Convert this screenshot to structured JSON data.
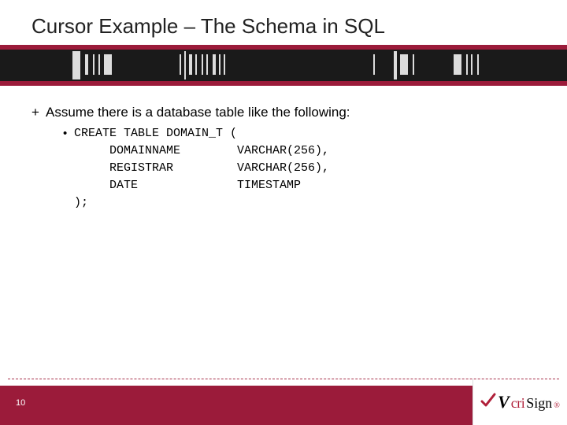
{
  "title": "Cursor Example – The Schema in SQL",
  "bullet_text": "Assume there is a database table like the following:",
  "code": "CREATE TABLE DOMAIN_T (\n     DOMAINNAME        VARCHAR(256),\n     REGISTRAR         VARCHAR(256),\n     DATE              TIMESTAMP\n);",
  "page_number": "10",
  "logo": {
    "v": "V",
    "mid": "cri",
    "tail": "Sign",
    "reg": "®"
  }
}
